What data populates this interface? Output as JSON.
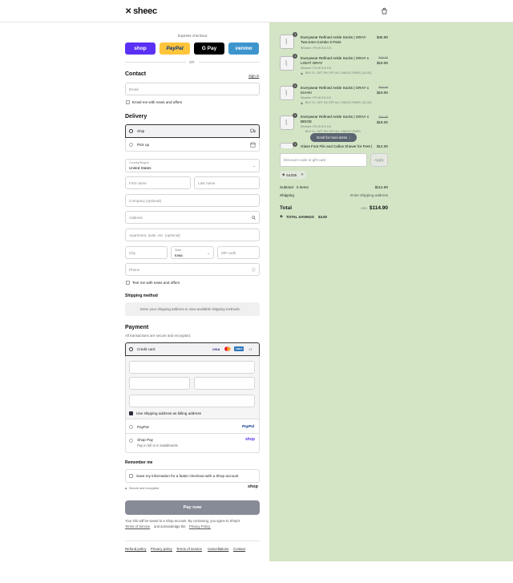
{
  "brand": {
    "name": "sheec"
  },
  "express": {
    "title": "Express checkout",
    "or": "OR",
    "buttons": {
      "shop": "shop",
      "paypal": "PayPal",
      "gpay": "G Pay",
      "venmo": "venmo"
    }
  },
  "contact": {
    "heading": "Contact",
    "sign_in": "Sign in",
    "email_placeholder": "Email",
    "email_news": "Email me with news and offers"
  },
  "delivery": {
    "heading": "Delivery",
    "ship": "Ship",
    "pickup": "Pick up",
    "country_label": "Country/Region",
    "country_value": "United States",
    "first_name": "First name",
    "last_name": "Last name",
    "company": "Company (optional)",
    "address": "Address",
    "apartment": "Apartment, suite, etc. (optional)",
    "city": "City",
    "state_label": "State",
    "state_value": "Iowa",
    "zip": "ZIP code",
    "phone": "Phone",
    "text_news": "Text me with news and offers"
  },
  "shipping_method": {
    "heading": "Shipping method",
    "note": "Enter your shipping address to view available shipping methods."
  },
  "payment": {
    "heading": "Payment",
    "subtitle": "All transactions are secure and encrypted.",
    "credit_card": "Credit card",
    "more_cards": "+1",
    "billing_same": "Use shipping address as billing address",
    "paypal": "PayPal",
    "shop_pay": "Shop Pay",
    "shop_pay_sub": "Pay in full or in installments"
  },
  "remember": {
    "heading": "Remember me",
    "save_info": "Save my information for a faster checkout with a Shop account",
    "secure": "Secure and encrypted",
    "shop_brand": "shop"
  },
  "pay_now": "Pay now",
  "legal": {
    "line1": "Your info will be saved to a Shop account. By continuing, you agree to Shop's",
    "terms": "Terms of Service",
    "mid": "and acknowledge the",
    "privacy": "Privacy Policy."
  },
  "footer_links": [
    "Refund policy",
    "Privacy policy",
    "Terms of service",
    "Cancellations",
    "Contact"
  ],
  "cart": {
    "items": [
      {
        "qty": "1",
        "name": "Everywear Refined Ankle Socks | GRAY Two-tone Combo 3 Pairs",
        "variant": "Women / Fit W 5.5-9.5",
        "discount": "",
        "compare": "",
        "price": "$45.90"
      },
      {
        "qty": "1",
        "name": "Everywear Refined Ankle Socks | GRAY x LIGHT GRAY",
        "variant": "Women / Fit W 5.5-9.5",
        "discount": "BUY 3+, GET 5% OFF ALL SINGLE PAIRS (-$1.00)",
        "compare": "$20.00",
        "price": "$19.00"
      },
      {
        "qty": "1",
        "name": "Everywear Refined Ankle Socks | GRAY x KHAKI",
        "variant": "Women / Fit W 5.5-9.5",
        "discount": "BUY 3+, GET 5% OFF ALL SINGLE PAIRS (-$1.00)",
        "compare": "$20.00",
        "price": "$19.00"
      },
      {
        "qty": "1",
        "name": "Everywear Refined Ankle Socks | GRAY x BEIGE",
        "variant": "Women / Fit W 5.5-9.5",
        "discount": "BUY 3+, GET 5% OFF ALL SINGLE PAIRS",
        "compare": "$20.00",
        "price": "$19.00"
      },
      {
        "qty": "1",
        "name": "Glass Foot File and Callus Shaver for Feet |",
        "variant": "",
        "discount": "",
        "compare": "",
        "price": "$12.00"
      }
    ],
    "scroll_hint": "Scroll for more items",
    "discount_placeholder": "Discount code or gift card",
    "apply": "Apply",
    "code_tag": "54JD5",
    "subtotal_label": "Subtotal · 5 items",
    "subtotal_value": "$114.90",
    "shipping_label": "Shipping",
    "shipping_value": "Enter shipping address",
    "total_label": "Total",
    "currency": "USD",
    "total_value": "$114.90",
    "savings_label": "TOTAL SAVINGS",
    "savings_value": "$3.00"
  },
  "colors": {
    "accent": "#5a31f4",
    "pay_button": "#878b97",
    "summary_bg": "#d3e5c5"
  }
}
